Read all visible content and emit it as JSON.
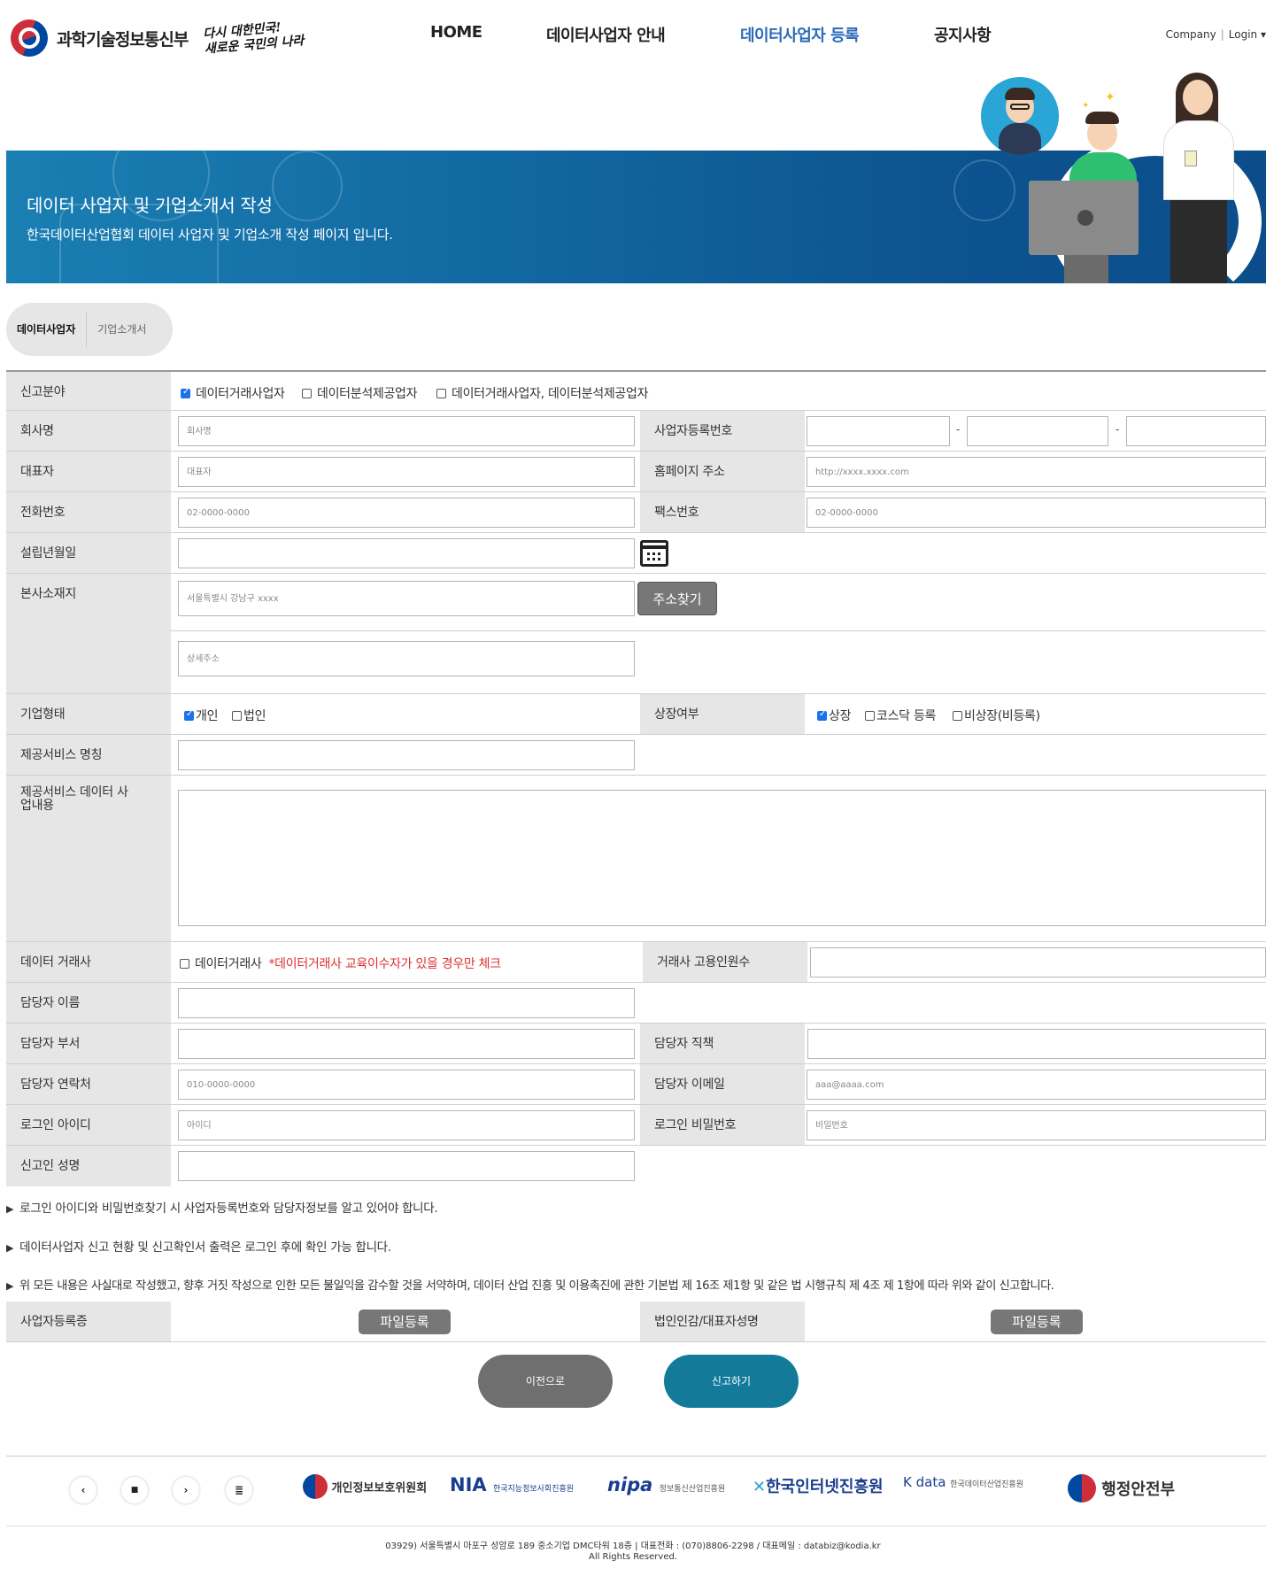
{
  "header": {
    "ministry": "과학기술정보통신부",
    "slogan_line1": "다시 대한민국!",
    "slogan_line2": "새로운 국민의 나라",
    "nav": [
      "HOME",
      "데이터사업자 안내",
      "데이터사업자 등록",
      "공지사항"
    ],
    "util_company": "Company",
    "util_login": "Login"
  },
  "banner": {
    "title": "데이터 사업자 및 기업소개서 작성",
    "subtitle": "한국데이터산업협회 데이터 사업자 및 기업소개 작성 페이지 입니다."
  },
  "tabs": [
    "데이터사업자",
    "기업소개서"
  ],
  "form": {
    "category_label": "신고분야",
    "category_options": [
      "데이터거래사업자",
      "데이터분석제공업자",
      "데이터거래사업자, 데이터분석제공업자"
    ],
    "company_label": "회사명",
    "company_placeholder": "회사명",
    "bizno_label": "사업자등록번호",
    "ceo_label": "대표자",
    "ceo_placeholder": "대표자",
    "homepage_label": "홈페이지 주소",
    "homepage_placeholder": "http://xxxx.xxxx.com",
    "phone_label": "전화번호",
    "phone_placeholder": "02-0000-0000",
    "fax_label": "팩스번호",
    "fax_placeholder": "02-0000-0000",
    "founded_label": "설립년월일",
    "address_label": "본사소재지",
    "address_placeholder": "서울특별시 강남구 xxxx",
    "address_button": "주소찾기",
    "address_detail_placeholder": "상세주소",
    "type_label": "기업형태",
    "type_options": [
      "개인",
      "법인"
    ],
    "listed_label": "상장여부",
    "listed_options": [
      "상장",
      "코스닥 등록",
      "비상장(비등록)"
    ],
    "service_name_label": "제공서비스 명칭",
    "service_desc_label": "제공서비스 데이터 사업내용",
    "broker_label": "데이터 거래사",
    "broker_option": "데이터거래사",
    "broker_note": "*데이터거래사 교육이수자가 있을 경우만 체크",
    "broker_count_label": "거래사 고용인원수",
    "manager_name_label": "담당자 이름",
    "manager_dept_label": "담당자 부서",
    "manager_title_label": "담당자 직책",
    "manager_phone_label": "담당자 연락처",
    "manager_phone_placeholder": "010-0000-0000",
    "manager_email_label": "담당자 이메일",
    "manager_email_placeholder": "aaa@aaaa.com",
    "login_id_label": "로그인 아이디",
    "login_id_placeholder": "아이디",
    "login_pw_label": "로그인 비밀번호",
    "login_pw_placeholder": "비밀번호",
    "reporter_label": "신고인 성명"
  },
  "notes": [
    "로그인 아이디와 비밀번호찾기 시 사업자등록번호와 담당자정보를 알고 있어야 합니다.",
    "데이터사업자 신고 현황 및 신고확인서 출력은 로그인 후에 확인 가능 합니다.",
    "위 모든 내용은 사실대로 작성했고, 향후 거짓 작성으로 인한 모든 불일익을 감수할 것을 서약하며, 데이터 산업 진흥 및 이용촉진에 관한 기본법 제 16조 제1항 및 같은 법 시행규칙 제 4조 제 1항에 따라 위와 같이 신고합니다."
  ],
  "files": {
    "biz_cert_label": "사업자등록증",
    "seal_label": "법인인감/대표자성명",
    "upload_button": "파일등록"
  },
  "actions": {
    "prev": "이전으로",
    "submit": "신고하기"
  },
  "footer": {
    "controls": [
      "‹",
      "■",
      "›",
      "≣"
    ],
    "partners": [
      {
        "name": "개인정보보호위원회"
      },
      {
        "name": "NIA",
        "sub": "한국지능정보사회진흥원"
      },
      {
        "name": "nipa",
        "sub": "정보통신산업진흥원"
      },
      {
        "name": "한국인터넷진흥원"
      },
      {
        "name": "K data",
        "sub": "한국데이터산업진흥원"
      },
      {
        "name": "행정안전부"
      }
    ],
    "address": "03929) 서울특별시 마포구 성암로 189 중소기업 DMC타워 18층 | 대표전화 : (070)8806-2298 / 대표메일 : databiz@kodia.kr",
    "copyright": "All Rights Reserved."
  },
  "colors": {
    "active_nav": "#2a6ab8",
    "banner": "#11659e",
    "submit": "#137a9a",
    "prev": "#6f6f6f"
  }
}
